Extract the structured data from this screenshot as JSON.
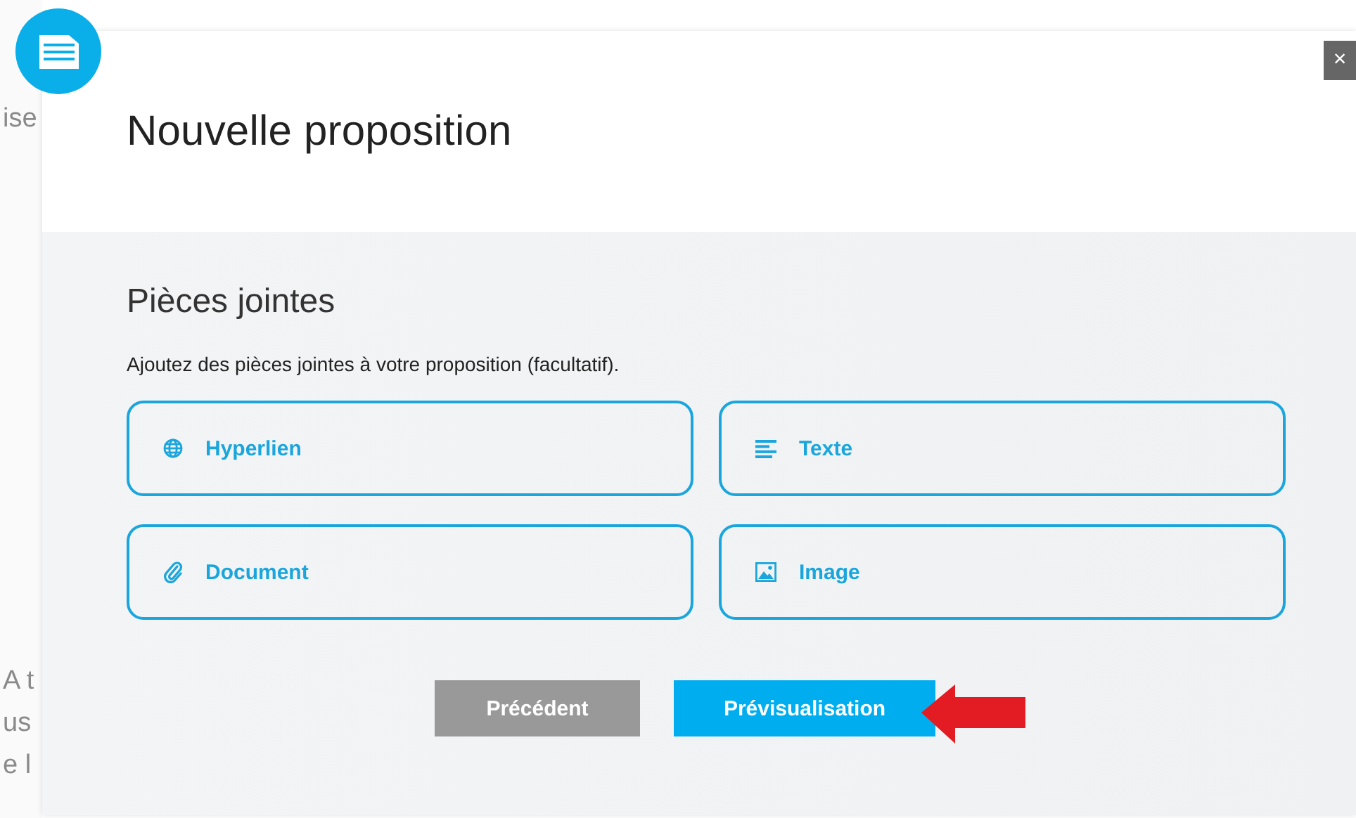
{
  "background": {
    "fragments": [
      "ise",
      "A t",
      "us",
      "e l"
    ]
  },
  "dialog": {
    "title": "Nouvelle proposition",
    "close": "×"
  },
  "section": {
    "title": "Pièces jointes",
    "description": "Ajoutez des pièces jointes à votre proposition (facultatif)."
  },
  "attachments": [
    {
      "kind": "link",
      "label": "Hyperlien"
    },
    {
      "kind": "text",
      "label": "Texte"
    },
    {
      "kind": "document",
      "label": "Document"
    },
    {
      "kind": "image",
      "label": "Image"
    }
  ],
  "buttons": [
    {
      "kind": "secondary",
      "label": "Précédent"
    },
    {
      "kind": "primary",
      "label": "Prévisualisation",
      "highlighted": true
    }
  ]
}
